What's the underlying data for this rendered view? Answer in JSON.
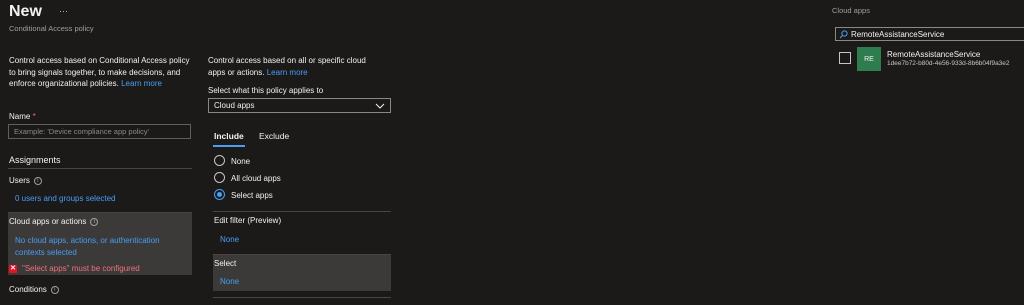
{
  "header": {
    "title": "New",
    "more_label": "···",
    "subtitle": "Conditional Access policy"
  },
  "left": {
    "description": "Control access based on Conditional Access policy to bring signals together, to make decisions, and enforce organizational policies.",
    "learn_more": "Learn more",
    "name_label": "Name",
    "required_mark": "*",
    "name_placeholder": "Example: 'Device compliance app policy'",
    "assignments_heading": "Assignments",
    "users_label": "Users",
    "users_value": "0 users and groups selected",
    "cloud_apps_label": "Cloud apps or actions",
    "cloud_apps_value": "No cloud apps, actions, or authentication contexts selected",
    "error_text": "\"Select apps\" must be configured",
    "conditions_label": "Conditions"
  },
  "middle": {
    "description": "Control access based on all or specific cloud apps or actions.",
    "learn_more": "Learn more",
    "select_label": "Select what this policy applies to",
    "select_value": "Cloud apps",
    "tabs": [
      {
        "label": "Include"
      },
      {
        "label": "Exclude"
      }
    ],
    "radios": [
      {
        "label": "None",
        "checked": false
      },
      {
        "label": "All cloud apps",
        "checked": false
      },
      {
        "label": "Select apps",
        "checked": true
      }
    ],
    "edit_filter_label": "Edit filter (Preview)",
    "edit_filter_value": "None",
    "select_heading": "Select",
    "select_section_value": "None"
  },
  "right": {
    "heading": "Cloud apps",
    "search_value": "RemoteAssistanceService",
    "apps": [
      {
        "initials": "RE",
        "name": "RemoteAssistanceService",
        "id": "1dee7b72-b80d-4e56-933d-8b6b04f9a3e2",
        "avatar_color": "#2e7d4f"
      }
    ]
  },
  "colors": {
    "accent": "#479ef5",
    "error": "#f1707b",
    "avatar": "#2e7d4f"
  }
}
